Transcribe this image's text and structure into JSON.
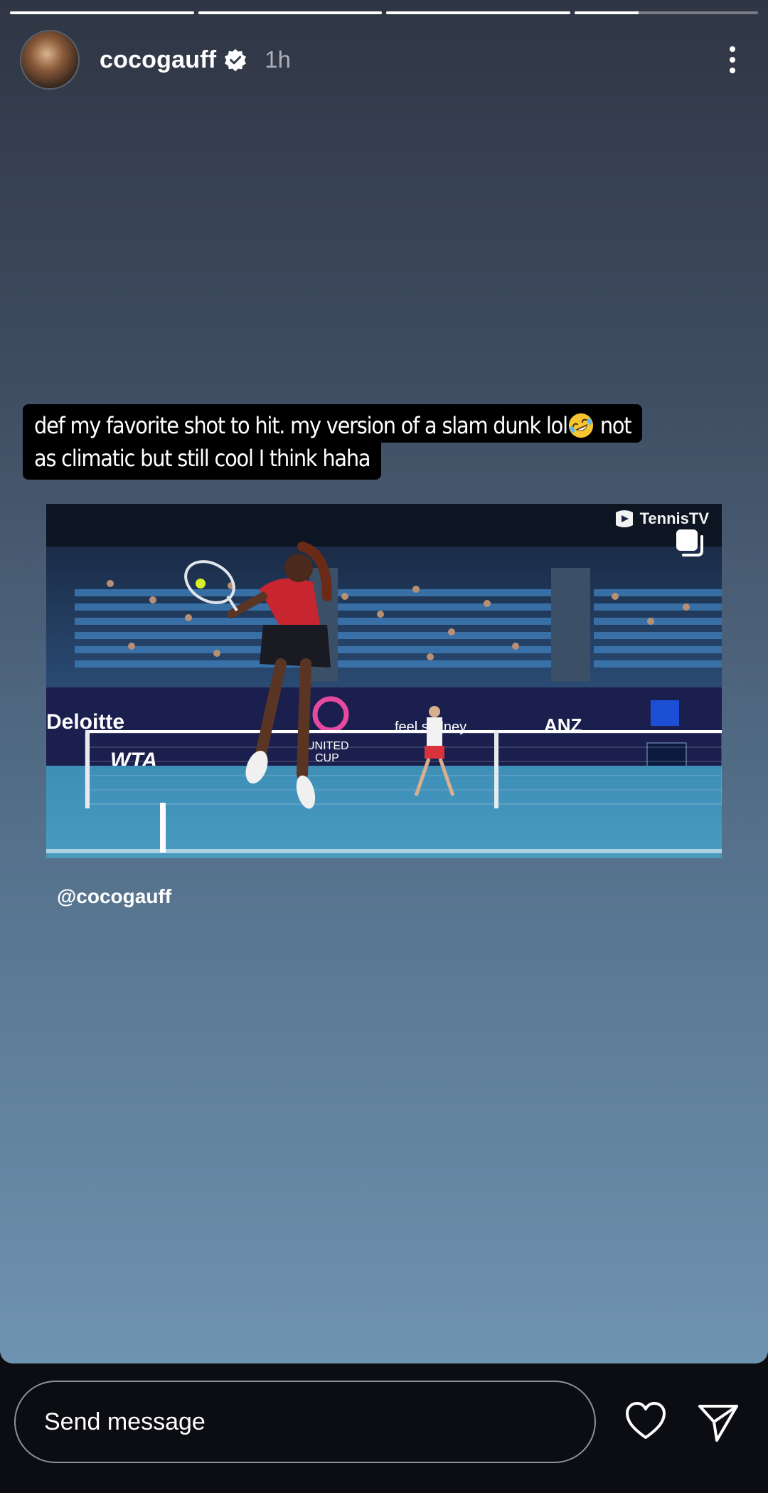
{
  "story": {
    "progress_segments": [
      1,
      1,
      1,
      0.35
    ],
    "user": {
      "username": "cocogauff",
      "verified": true,
      "time_ago": "1h",
      "avatar_icon": "profile-avatar"
    },
    "menu_icon": "more-vertical-icon",
    "caption": {
      "line1_text": "def my favorite shot to hit. my version of a slam dunk lol",
      "line1_emoji": "rolling-on-floor-laughing-emoji",
      "line1_tail": " not",
      "line2_text": "as climatic but still cool I think haha"
    },
    "video": {
      "watermark": "TennisTV",
      "copy_icon": "copy-icon"
    },
    "mention": "@cocogauff"
  },
  "footer": {
    "message_placeholder": "Send message",
    "like_icon": "heart-icon",
    "share_icon": "send-icon"
  },
  "colors": {
    "background_top": "#2f3644",
    "background_bottom": "#6e93b1",
    "footer_bg": "#0b0d12",
    "verified_blue": "#ffffff"
  }
}
